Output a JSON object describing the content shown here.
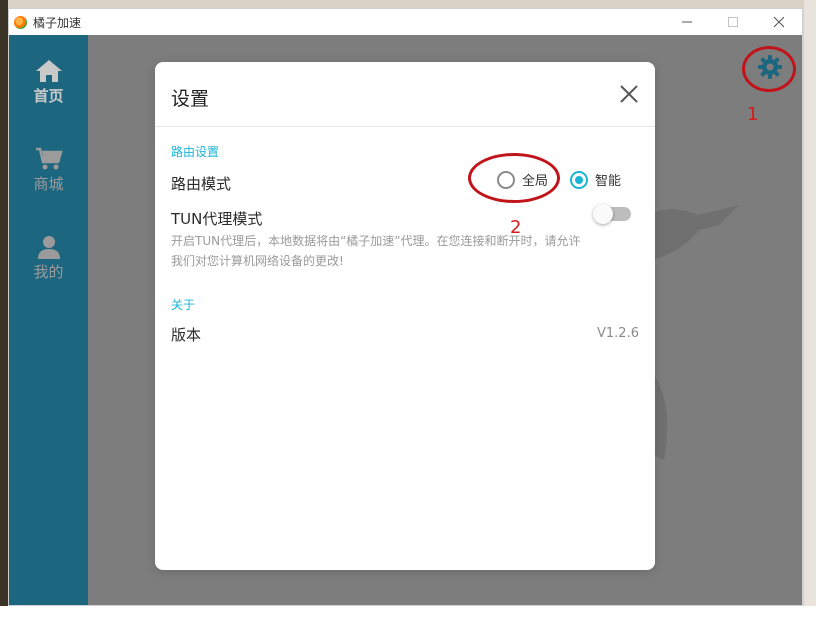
{
  "window": {
    "title": "橘子加速",
    "controls": {
      "minimize": "—",
      "maximize": "☐",
      "close": "✕"
    }
  },
  "sidebar": {
    "items": [
      {
        "label": "首页",
        "icon": "home-icon",
        "active": true
      },
      {
        "label": "商城",
        "icon": "cart-icon",
        "active": false
      },
      {
        "label": "我的",
        "icon": "user-icon",
        "active": false
      }
    ]
  },
  "toolbar": {
    "settings_icon": "gear-icon"
  },
  "annotations": {
    "marker1": "1",
    "marker2": "2",
    "color": "#c0141a"
  },
  "settings_dialog": {
    "title": "设置",
    "close_icon": "close-icon",
    "route_section": {
      "header": "路由设置",
      "route_mode_label": "路由模式",
      "options": [
        {
          "label": "全局",
          "selected": false
        },
        {
          "label": "智能",
          "selected": true
        }
      ]
    },
    "tun": {
      "label": "TUN代理模式",
      "enabled": false,
      "description_line1": "开启TUN代理后，本地数据将由“橘子加速”代理。在您连接和断开时，请允许",
      "description_line2": "我们对您计算机网络设备的更改!"
    },
    "about_section": {
      "header": "关于",
      "version_label": "版本",
      "version_value": "V1.2.6"
    }
  },
  "colors": {
    "accent": "#19b4d6",
    "sidebar": "#1d6680",
    "gear": "#1d6680"
  }
}
